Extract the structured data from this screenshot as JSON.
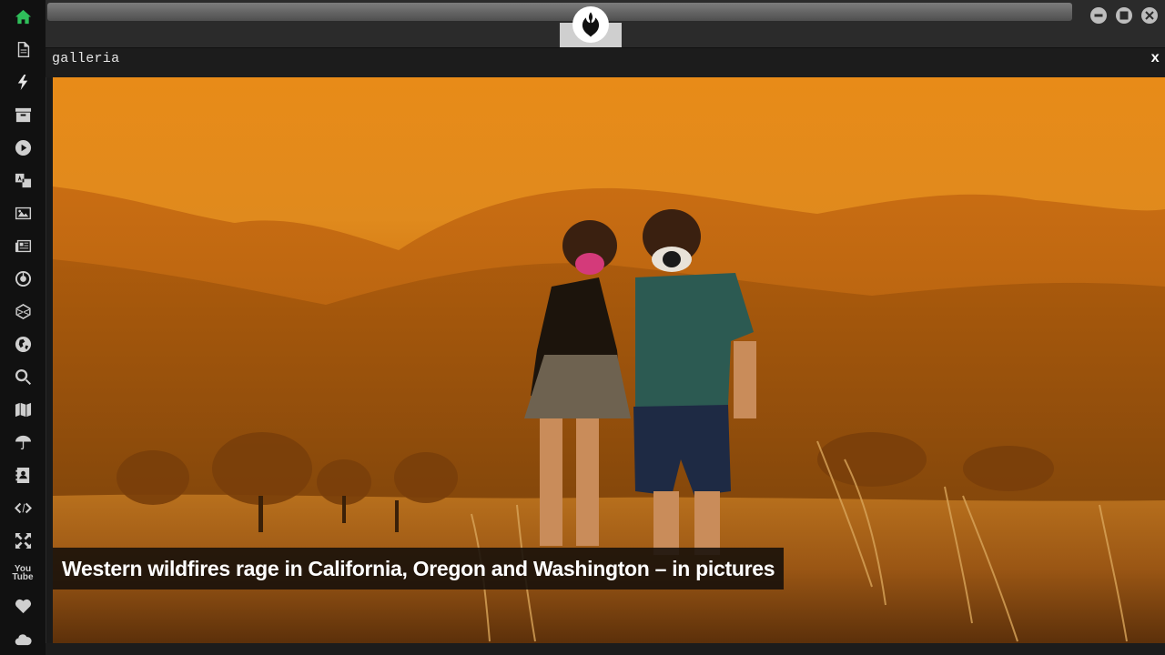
{
  "window": {
    "panel_title": "galleria",
    "close_label": "x"
  },
  "sidebar": {
    "items": [
      {
        "icon": "home-icon",
        "active": true
      },
      {
        "icon": "document-icon"
      },
      {
        "icon": "lightning-icon"
      },
      {
        "icon": "archive-icon"
      },
      {
        "icon": "play-icon"
      },
      {
        "icon": "translate-icon"
      },
      {
        "icon": "image-icon"
      },
      {
        "icon": "newspaper-icon"
      },
      {
        "icon": "empire-icon"
      },
      {
        "icon": "hexagon-icon"
      },
      {
        "icon": "globe-icon"
      },
      {
        "icon": "search-icon"
      },
      {
        "icon": "map-icon"
      },
      {
        "icon": "umbrella-icon"
      },
      {
        "icon": "contact-book-icon"
      },
      {
        "icon": "code-icon"
      },
      {
        "icon": "expand-icon"
      },
      {
        "icon": "youtube-icon",
        "label": "You\nTube"
      },
      {
        "icon": "heart-icon"
      },
      {
        "icon": "cloud-icon"
      }
    ]
  },
  "gallery": {
    "caption": "Western wildfires rage in California, Oregon and Washington – in pictures"
  },
  "colors": {
    "active_icon": "#2fbf5a",
    "sky_orange": "#e88b18"
  }
}
